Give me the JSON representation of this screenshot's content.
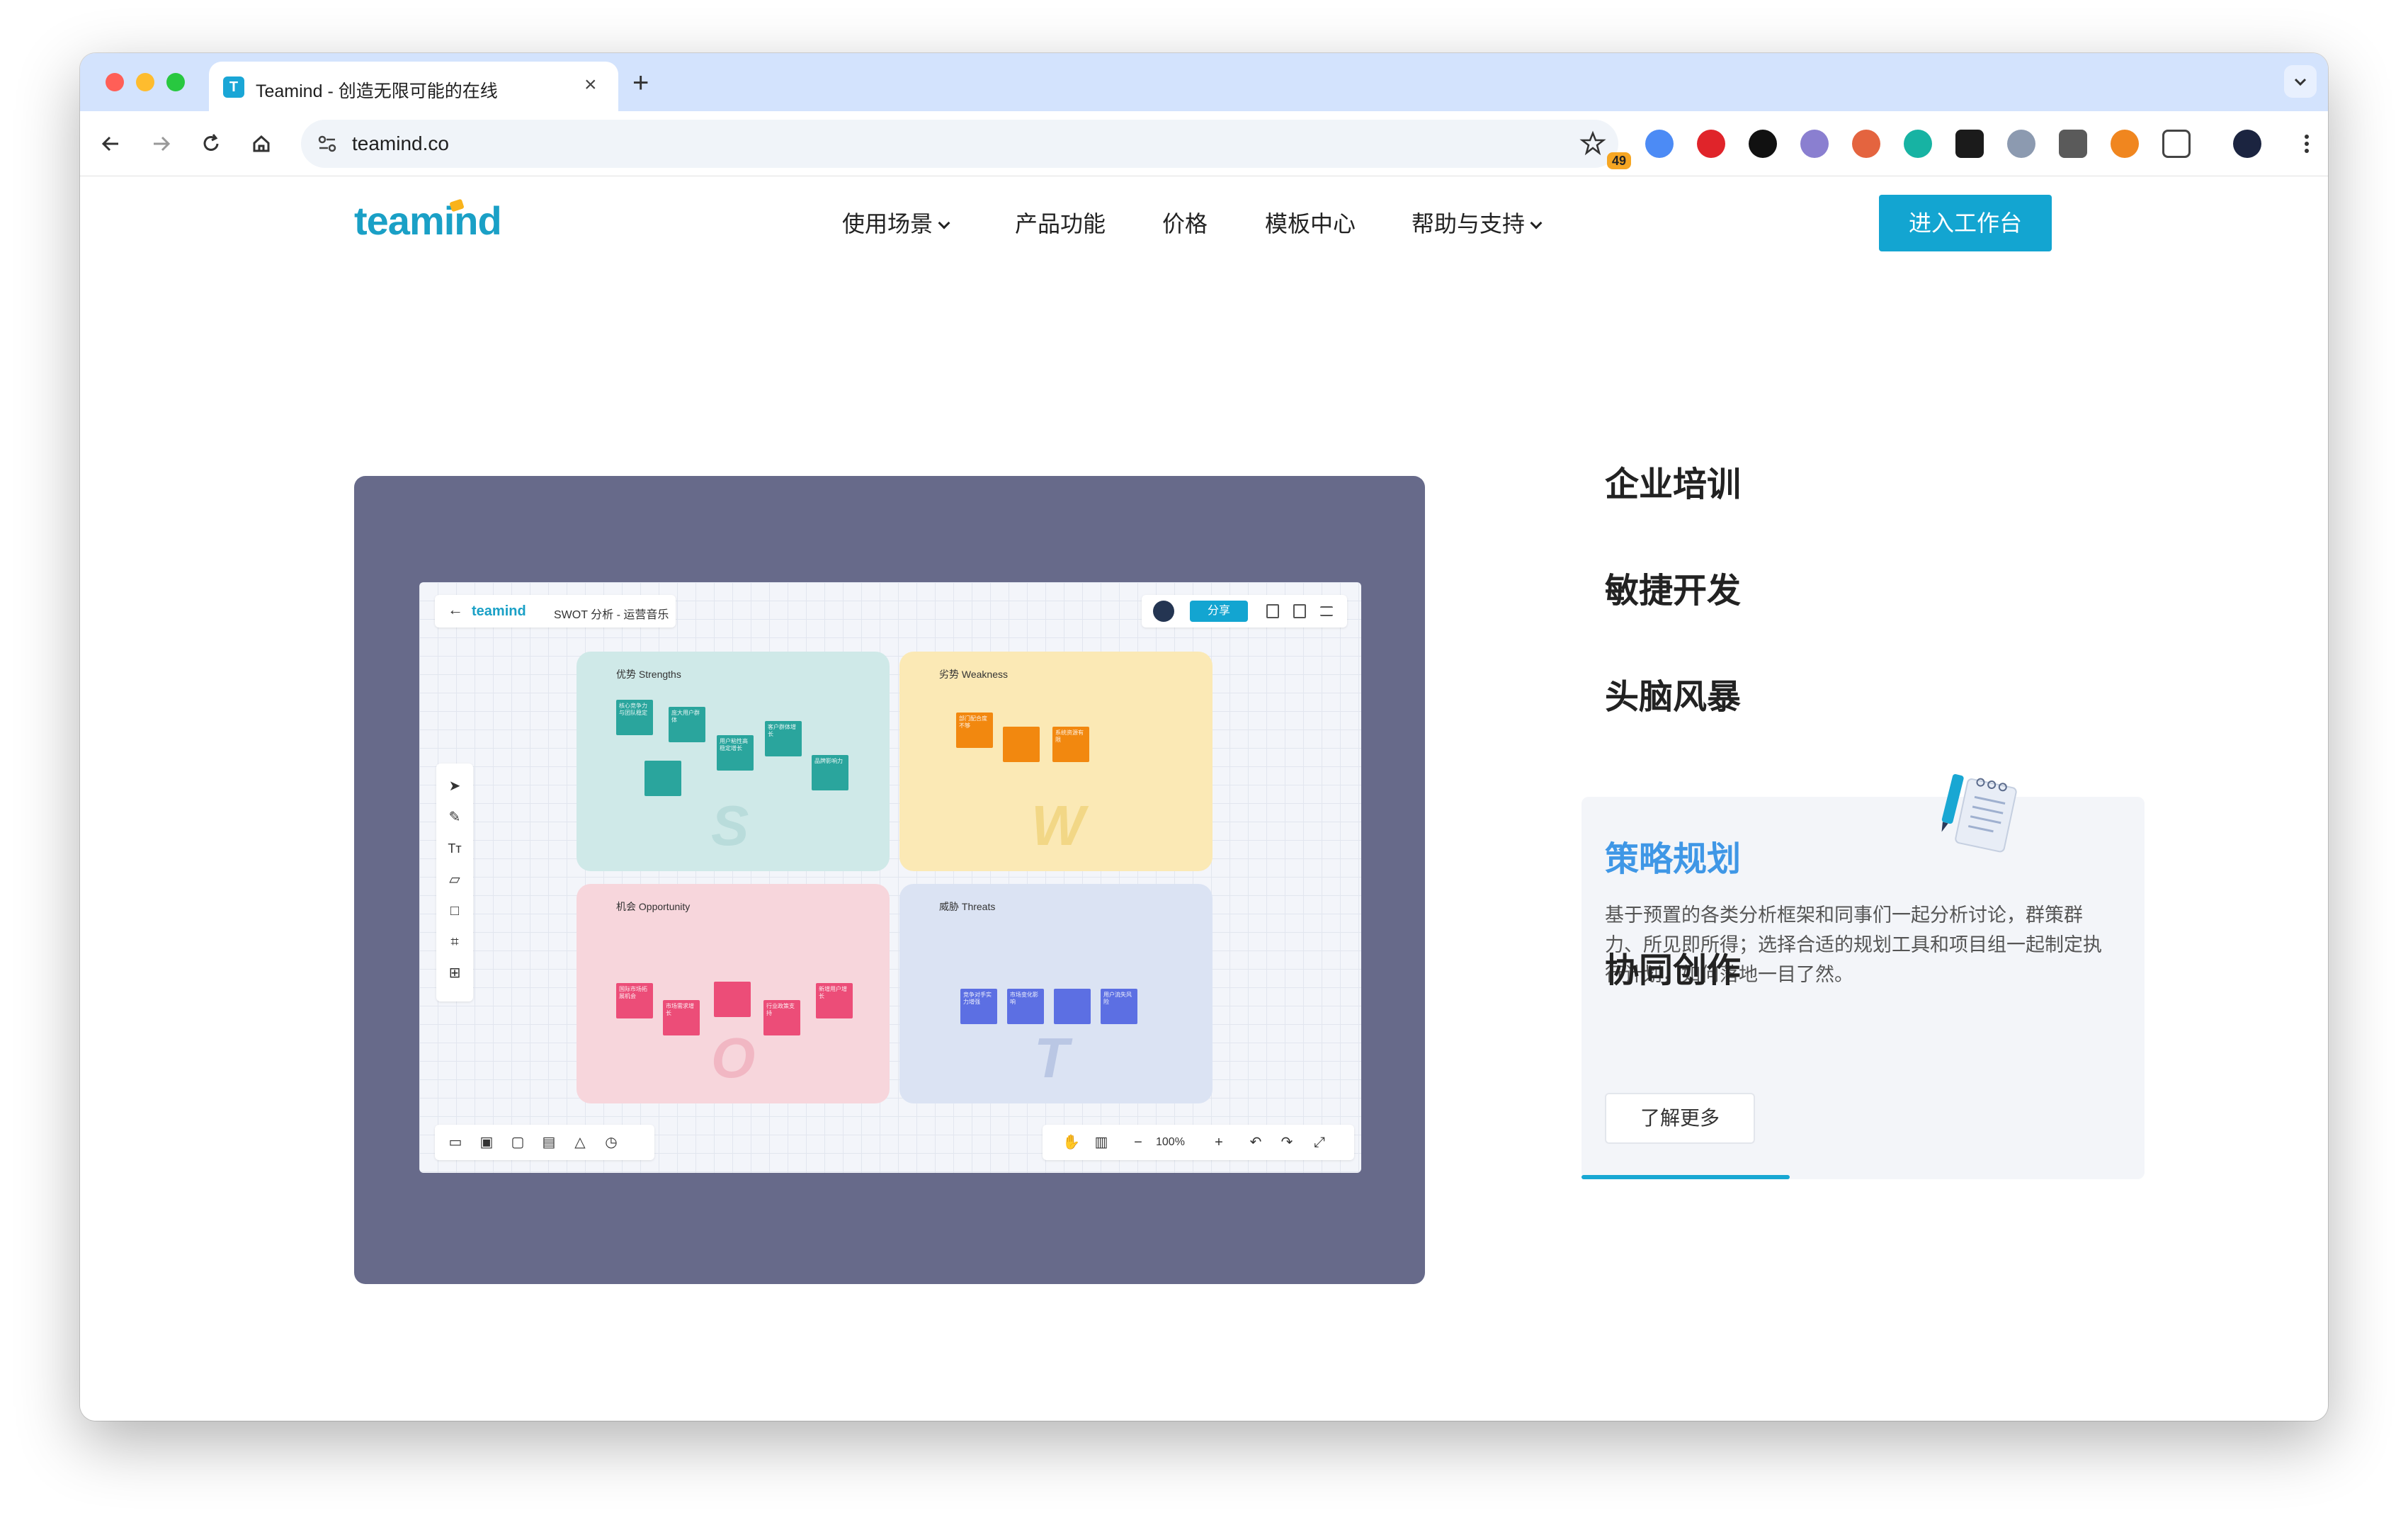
{
  "browser": {
    "tab_title": "Teamind - 创造无限可能的在线",
    "favicon_text": "T",
    "url": "teamind.co",
    "extension_badge": "49",
    "traffic_lights": [
      "#ff5f57",
      "#febc2e",
      "#28c840"
    ]
  },
  "site": {
    "logo": "teamind",
    "nav": [
      {
        "label": "使用场景",
        "dropdown": true
      },
      {
        "label": "产品功能",
        "dropdown": false
      },
      {
        "label": "价格",
        "dropdown": false
      },
      {
        "label": "模板中心",
        "dropdown": false
      },
      {
        "label": "帮助与支持",
        "dropdown": true
      }
    ],
    "cta": "进入工作台",
    "accent": "#13a5d1"
  },
  "preview": {
    "logo": "teamind",
    "doc_title": "SWOT 分析 - 运营音乐",
    "share": "分享",
    "zoom": "100%",
    "quadrants": [
      {
        "label": "优势 Strengths",
        "letter": "S",
        "color": "#cfe9e8",
        "note_color": "#2aa59d"
      },
      {
        "label": "劣势 Weakness",
        "letter": "W",
        "color": "#fbe9b5",
        "note_color": "#f2880f"
      },
      {
        "label": "机会 Opportunity",
        "letter": "O",
        "color": "#f7d6dc",
        "note_color": "#ec4d78"
      },
      {
        "label": "威胁 Threats",
        "letter": "T",
        "color": "#dbe3f3",
        "note_color": "#5c6fe3"
      }
    ],
    "notes": {
      "s": [
        "核心竞争力与团队稳定",
        "庞大用户群体",
        "",
        "用户粘性高稳定增长",
        "",
        "客户群体增长",
        "品牌影响力"
      ],
      "w": [
        "部门配合度不够",
        "",
        "系统资源有限",
        "竞争差异不足"
      ],
      "o": [
        "国际市场拓展机会",
        "市场需求增长",
        "",
        "行业政策支持",
        "新增用户增长"
      ],
      "t": [
        "竞争对手实力增强",
        "市场变化影响",
        "",
        "用户流失风险"
      ]
    }
  },
  "scenarios": {
    "items": [
      "企业培训",
      "敏捷开发",
      "头脑风暴",
      "协同创作"
    ],
    "active": {
      "title": "策略规划",
      "description": "基于预置的各类分析框架和同事们一起分析讨论，群策群力、所见即所得；选择合适的规划工具和项目组一起制定执行计划，如何落地一目了然。",
      "button": "了解更多",
      "progress": 0.37
    }
  }
}
